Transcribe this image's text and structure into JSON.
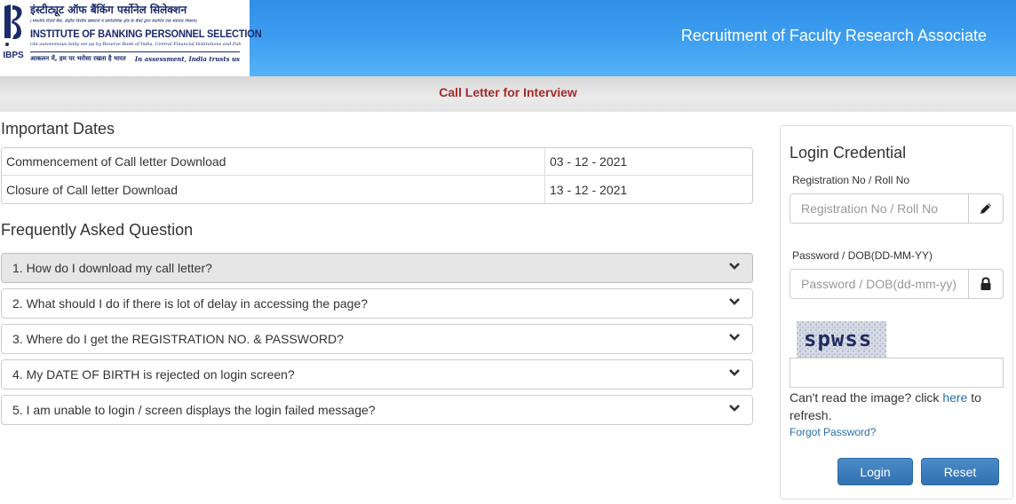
{
  "header": {
    "logo": {
      "abbr": "IBPS",
      "hindi_name": "इंस्टीट्यूट ऑफ बैंकिंग पर्सोनेल सिलेक्शन",
      "hindi_sub": "(भारतीय रिज़र्व बैंक, केंद्रीय वित्तीय संस्थानों व सार्वजनिक क्षेत्र के बैंकों द्वारा स्थापित एक स्वायत्त निकाय)",
      "english_name": "INSTITUTE OF BANKING PERSONNEL SELECTION",
      "english_sub": "(An autonomous body set up by Reserve Bank of India, Central Financial Institutions and Public Sector Banks)",
      "tagline_hindi": "आकलन में, हम पर भरोसा रखता है भारत",
      "tagline_english": "In assessment, India trusts us"
    },
    "title": "Recruitment of Faculty Research Associate"
  },
  "subbar": {
    "title": "Call Letter for Interview"
  },
  "important_dates": {
    "title": "Important Dates",
    "rows": [
      {
        "label": "Commencement of Call letter Download",
        "date": "03 - 12 - 2021"
      },
      {
        "label": "Closure of Call letter Download",
        "date": "13 - 12 - 2021"
      }
    ]
  },
  "faq": {
    "title": "Frequently Asked Question",
    "items": [
      {
        "question": "1. How do I download my call letter?"
      },
      {
        "question": "2. What should I do if there is lot of delay in accessing the page?"
      },
      {
        "question": "3. Where do I get the REGISTRATION NO. & PASSWORD?"
      },
      {
        "question": "4. My DATE OF BIRTH is rejected on login screen?"
      },
      {
        "question": "5. I am unable to login / screen displays the login failed message?"
      }
    ]
  },
  "login": {
    "title": "Login Credential",
    "reg_label": "Registration No / Roll No",
    "reg_placeholder": "Registration No / Roll No",
    "reg_value": "",
    "pwd_label": "Password / DOB(DD-MM-YY)",
    "pwd_placeholder": "Password / DOB(dd-mm-yy)",
    "pwd_value": "",
    "captcha_text": "spwss",
    "captcha_value": "",
    "refresh_prefix": "Can't read the image? click ",
    "refresh_link": "here",
    "refresh_suffix": " to refresh.",
    "forgot": "Forgot Password?",
    "login_button": "Login",
    "reset_button": "Reset"
  },
  "icons": {
    "reg_addon": "pencil-icon",
    "pwd_addon": "lock-icon",
    "faq_toggle": "chevron-down-icon"
  },
  "colors": {
    "header_blue": "#3d9ef0",
    "subbar_title": "#a52a2a",
    "button_blue": "#3a7bbd",
    "link_blue": "#2a6fb0"
  }
}
